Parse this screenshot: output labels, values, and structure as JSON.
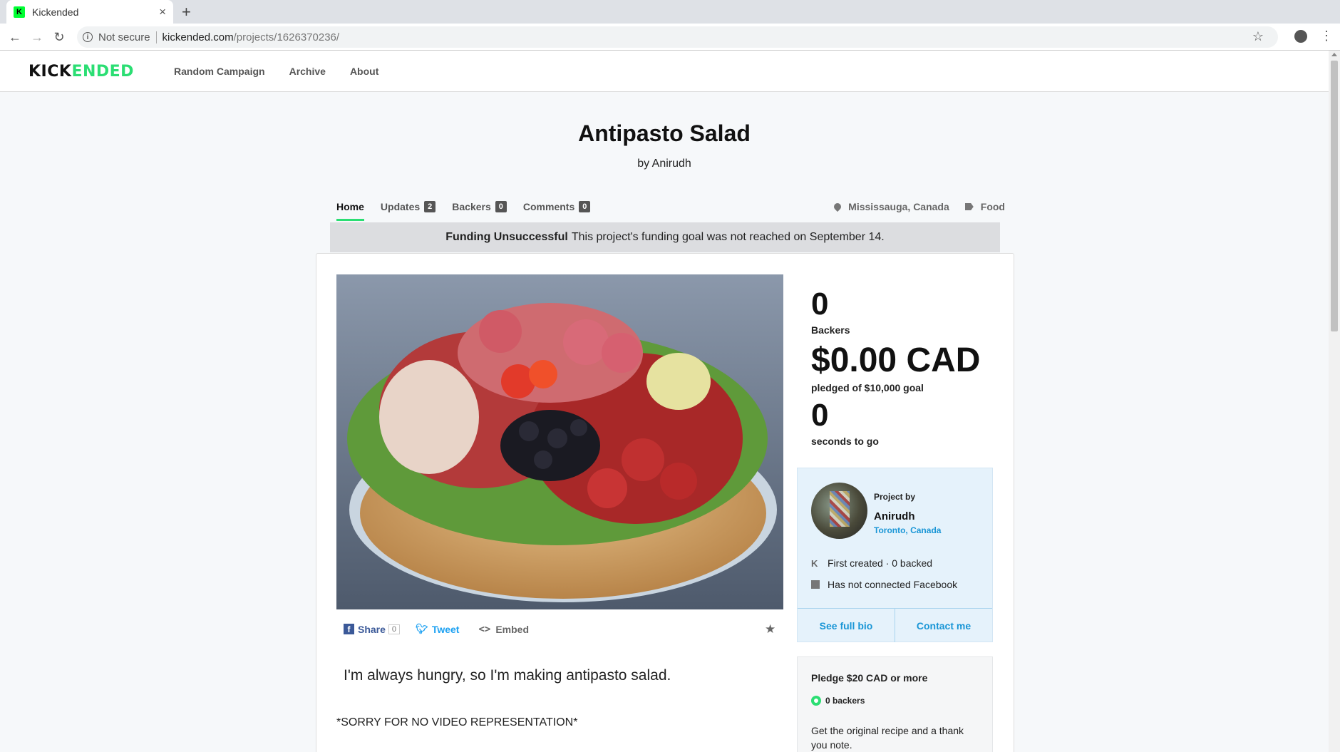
{
  "browser": {
    "tab_title": "Kickended",
    "tab_favicon_letter": "K",
    "security_label": "Not secure",
    "url_host": "kickended.com",
    "url_path": "/projects/1626370236/"
  },
  "site": {
    "logo_part1": "KICK",
    "logo_part2": "ENDED",
    "nav": [
      "Random Campaign",
      "Archive",
      "About"
    ]
  },
  "project": {
    "title": "Antipasto Salad",
    "byline": "by Anirudh",
    "tabs": [
      {
        "label": "Home"
      },
      {
        "label": "Updates",
        "count": "2"
      },
      {
        "label": "Backers",
        "count": "0"
      },
      {
        "label": "Comments",
        "count": "0"
      }
    ],
    "location": "Mississauga, Canada",
    "category": "Food",
    "banner_strong": "Funding Unsuccessful",
    "banner_text": "This project's funding goal was not reached on September 14.",
    "blurb": "I'm always hungry, so I'm making antipasto salad.",
    "note": "*SORRY FOR NO VIDEO REPRESENTATION*"
  },
  "share": {
    "facebook_label": "Share",
    "facebook_count": "0",
    "tweet_label": "Tweet",
    "embed_label": "Embed"
  },
  "stats": {
    "backers_value": "0",
    "backers_label": "Backers",
    "pledged_value": "$0.00 CAD",
    "pledged_label": "pledged of $10,000 goal",
    "time_value": "0",
    "time_label": "seconds to go"
  },
  "creator": {
    "heading": "Project by",
    "name": "Anirudh",
    "location": "Toronto, Canada",
    "fact_created": "First created · 0 backed",
    "fact_facebook": "Has not connected Facebook",
    "bio_button": "See full bio",
    "contact_button": "Contact me"
  },
  "reward": {
    "title": "Pledge $20 CAD or more",
    "backers": "0 backers",
    "description": "Get the original recipe and a thank you note."
  },
  "colors": {
    "accent": "#2bde73",
    "link": "#1a96d6",
    "facebook": "#3b5998",
    "twitter": "#1da1f2"
  }
}
